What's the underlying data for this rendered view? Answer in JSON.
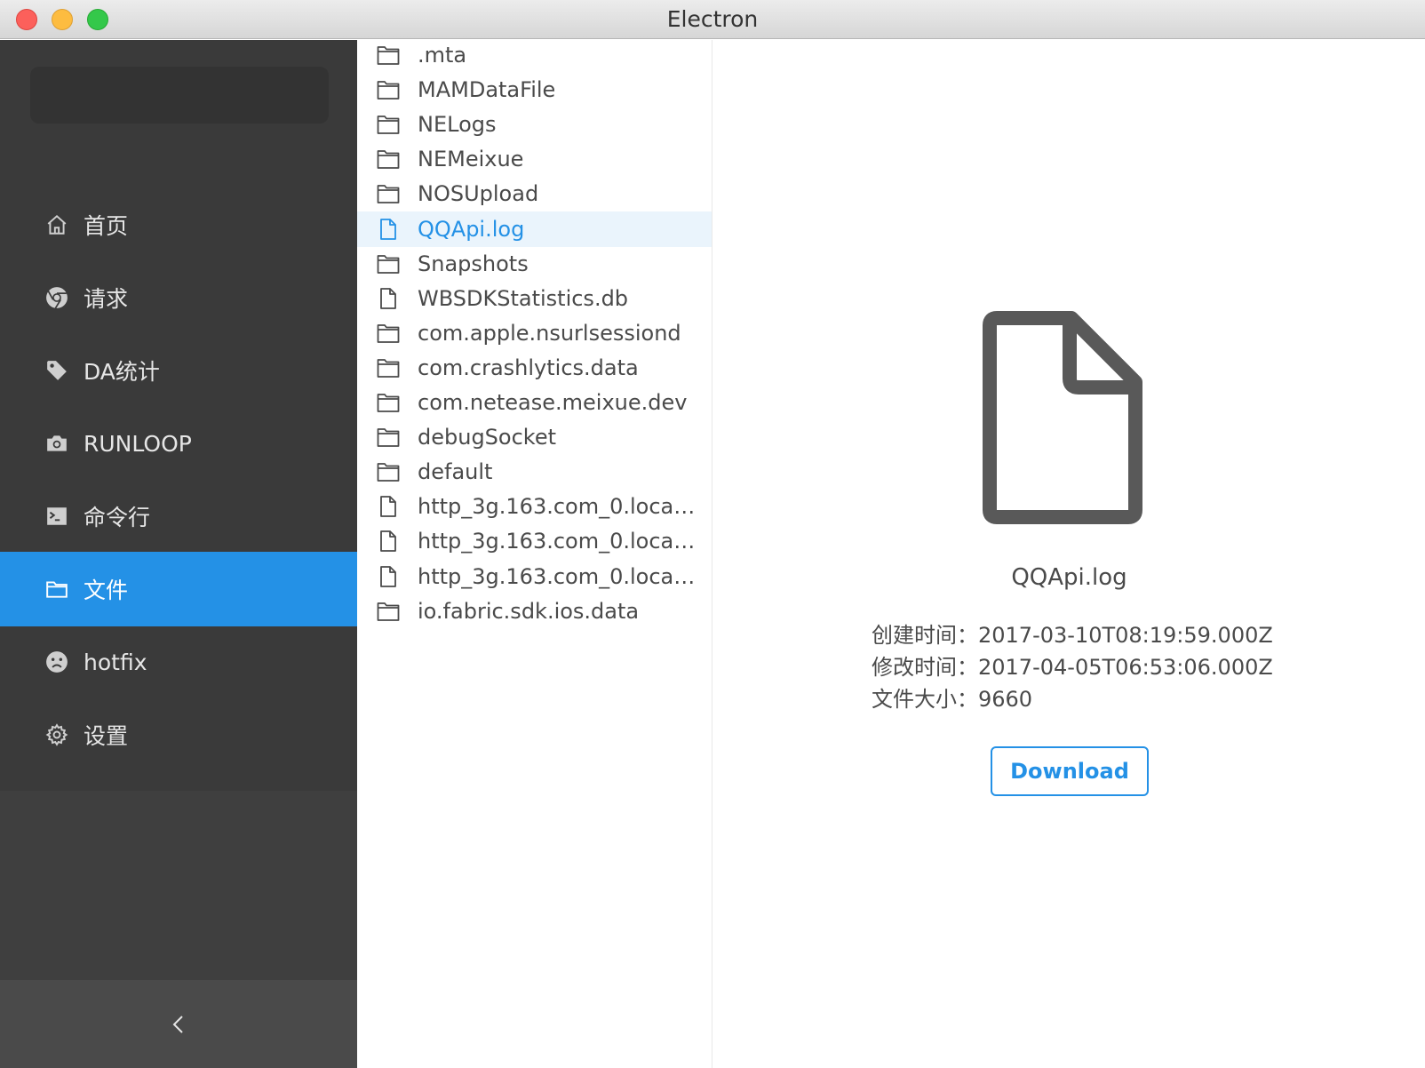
{
  "window": {
    "title": "Electron"
  },
  "sidebar": {
    "items": [
      {
        "label": "首页",
        "icon": "home-icon"
      },
      {
        "label": "请求",
        "icon": "chrome-icon"
      },
      {
        "label": "DA统计",
        "icon": "tag-icon"
      },
      {
        "label": "RUNLOOP",
        "icon": "camera-icon"
      },
      {
        "label": "命令行",
        "icon": "terminal-icon"
      },
      {
        "label": "文件",
        "icon": "folder-icon",
        "active": true
      },
      {
        "label": "hotfix",
        "icon": "frown-icon"
      },
      {
        "label": "设置",
        "icon": "gear-icon"
      }
    ],
    "collapse_icon": "chevron-left-icon"
  },
  "files": [
    {
      "name": ".mta",
      "type": "folder"
    },
    {
      "name": "MAMDataFile",
      "type": "folder"
    },
    {
      "name": "NELogs",
      "type": "folder"
    },
    {
      "name": "NEMeixue",
      "type": "folder"
    },
    {
      "name": "NOSUpload",
      "type": "folder"
    },
    {
      "name": "QQApi.log",
      "type": "file",
      "selected": true
    },
    {
      "name": "Snapshots",
      "type": "folder"
    },
    {
      "name": "WBSDKStatistics.db",
      "type": "file"
    },
    {
      "name": "com.apple.nsurlsessiond",
      "type": "folder"
    },
    {
      "name": "com.crashlytics.data",
      "type": "folder"
    },
    {
      "name": "com.netease.meixue.dev",
      "type": "folder"
    },
    {
      "name": "debugSocket",
      "type": "folder"
    },
    {
      "name": "default",
      "type": "folder"
    },
    {
      "name": "http_3g.163.com_0.locals...",
      "type": "file"
    },
    {
      "name": "http_3g.163.com_0.locals...",
      "type": "file"
    },
    {
      "name": "http_3g.163.com_0.locals...",
      "type": "file"
    },
    {
      "name": "io.fabric.sdk.ios.data",
      "type": "folder"
    }
  ],
  "detail": {
    "icon": "file-icon",
    "name": "QQApi.log",
    "created_label": "创建时间：",
    "created_value": "2017-03-10T08:19:59.000Z",
    "modified_label": "修改时间：",
    "modified_value": "2017-04-05T06:53:06.000Z",
    "size_label": "文件大小：",
    "size_value": "9660",
    "download_label": "Download"
  },
  "colors": {
    "accent": "#2491e6",
    "sidebar_bg": "#3a3a3a",
    "selected_row_bg": "#eaf4fc"
  }
}
